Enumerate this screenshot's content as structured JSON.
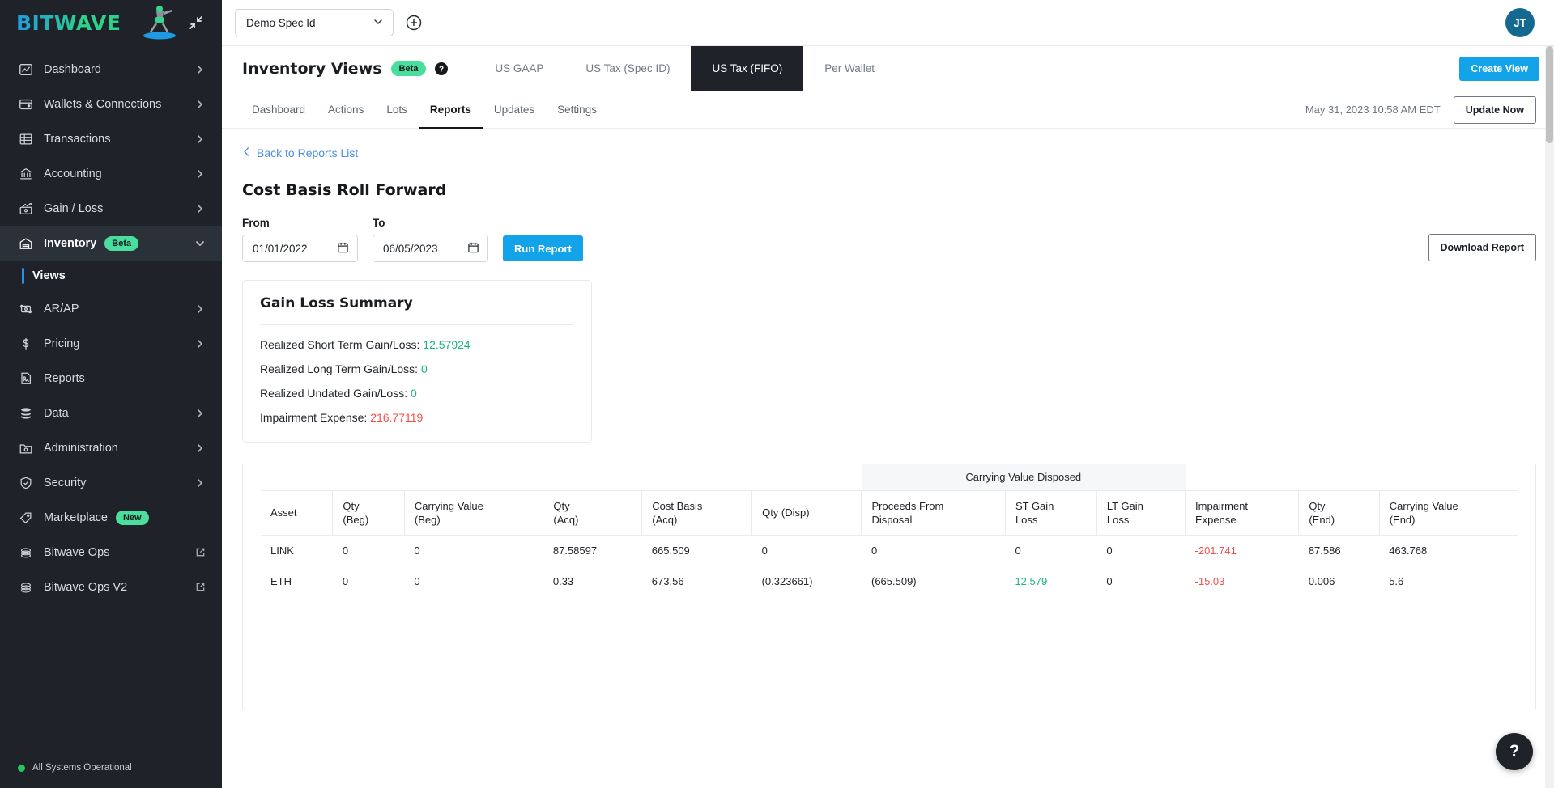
{
  "brand": {
    "name": "BITWAVE",
    "logo_icon": "surfer-logo",
    "collapse_icon": "collapse-icon"
  },
  "sidebar": {
    "items": [
      {
        "label": "Dashboard",
        "icon": "chart-line-icon",
        "chevron": true
      },
      {
        "label": "Wallets & Connections",
        "icon": "wallet-icon",
        "chevron": true
      },
      {
        "label": "Transactions",
        "icon": "table-icon",
        "chevron": true
      },
      {
        "label": "Accounting",
        "icon": "bank-icon",
        "chevron": true
      },
      {
        "label": "Gain / Loss",
        "icon": "gain-loss-icon",
        "chevron": true
      },
      {
        "label": "Inventory",
        "icon": "warehouse-icon",
        "badge": "Beta",
        "chevron": true,
        "active": true
      },
      {
        "label": "AR/AP",
        "icon": "money-transfer-icon",
        "chevron": true
      },
      {
        "label": "Pricing",
        "icon": "dollar-icon",
        "chevron": true
      },
      {
        "label": "Reports",
        "icon": "document-icon",
        "chevron": false
      },
      {
        "label": "Data",
        "icon": "database-icon",
        "chevron": true
      },
      {
        "label": "Administration",
        "icon": "admin-folder-icon",
        "chevron": true
      },
      {
        "label": "Security",
        "icon": "shield-check-icon",
        "chevron": true
      },
      {
        "label": "Marketplace",
        "icon": "tag-icon",
        "badge": "New",
        "chevron": false
      },
      {
        "label": "Bitwave Ops",
        "icon": "stack-icon",
        "external": true
      },
      {
        "label": "Bitwave Ops V2",
        "icon": "stack-icon",
        "external": true
      }
    ],
    "sub_item": {
      "label": "Views"
    },
    "status": {
      "text": "All Systems Operational",
      "color": "#22c55e"
    }
  },
  "topbar": {
    "spec_select": {
      "value": "Demo Spec Id",
      "chevron_icon": "chevron-down-icon"
    },
    "add_icon": "plus-circle-icon",
    "avatar": {
      "initials": "JT"
    }
  },
  "view_header": {
    "title": "Inventory Views",
    "badge": "Beta",
    "help_icon": "help-circle-icon",
    "tabs": [
      {
        "label": "US GAAP",
        "active": false
      },
      {
        "label": "US Tax (Spec ID)",
        "active": false
      },
      {
        "label": "US Tax (FIFO)",
        "active": true
      },
      {
        "label": "Per Wallet",
        "active": false
      }
    ],
    "create_view_label": "Create View"
  },
  "subnav": {
    "tabs": [
      {
        "label": "Dashboard",
        "active": false
      },
      {
        "label": "Actions",
        "active": false
      },
      {
        "label": "Lots",
        "active": false
      },
      {
        "label": "Reports",
        "active": true
      },
      {
        "label": "Updates",
        "active": false
      },
      {
        "label": "Settings",
        "active": false
      }
    ],
    "timestamp": "May 31, 2023 10:58 AM EDT",
    "update_now_label": "Update Now"
  },
  "report": {
    "back_link": "Back to Reports List",
    "back_icon": "chevron-left-icon",
    "title": "Cost Basis Roll Forward",
    "from_label": "From",
    "to_label": "To",
    "from_value": "01/01/2022",
    "to_value": "06/05/2023",
    "calendar_icon": "calendar-icon",
    "run_report_label": "Run Report",
    "download_report_label": "Download Report"
  },
  "summary": {
    "title": "Gain Loss Summary",
    "rows": [
      {
        "label": "Realized Short Term Gain/Loss:",
        "value": "12.57924",
        "tone": "green"
      },
      {
        "label": "Realized Long Term Gain/Loss:",
        "value": "0",
        "tone": "green"
      },
      {
        "label": "Realized Undated Gain/Loss:",
        "value": "0",
        "tone": "green"
      },
      {
        "label": "Impairment Expense:",
        "value": "216.77119",
        "tone": "red"
      }
    ]
  },
  "table": {
    "group_header": "Carrying Value Disposed",
    "columns": [
      "Asset",
      "Qty\n(Beg)",
      "Carrying Value\n(Beg)",
      "Qty\n(Acq)",
      "Cost Basis\n(Acq)",
      "Qty (Disp)",
      "Proceeds From\nDisposal",
      "ST Gain\nLoss",
      "LT Gain\nLoss",
      "Impairment\nExpense",
      "Qty\n(End)",
      "Carrying Value\n(End)"
    ],
    "columns_line1": [
      "Asset",
      "Qty",
      "Carrying Value",
      "Qty",
      "Cost Basis",
      "Qty (Disp)",
      "Proceeds From",
      "ST Gain",
      "LT Gain",
      "Impairment",
      "Qty",
      "Carrying Value"
    ],
    "columns_line2": [
      "",
      "(Beg)",
      "(Beg)",
      "(Acq)",
      "(Acq)",
      "",
      "Disposal",
      "Loss",
      "Loss",
      "Expense",
      "(End)",
      "(End)"
    ],
    "rows": [
      {
        "asset": "LINK",
        "qty_beg": "0",
        "carrying_value_beg": "0",
        "qty_acq": "87.58597",
        "cost_basis_acq": "665.509",
        "qty_disp": "0",
        "proceeds_from_disposal": "0",
        "st_gain_loss": "0",
        "st_tone": "neutral",
        "lt_gain_loss": "0",
        "impairment_expense": "-201.741",
        "impairment_tone": "red",
        "qty_end": "87.586",
        "carrying_value_end": "463.768"
      },
      {
        "asset": "ETH",
        "qty_beg": "0",
        "carrying_value_beg": "0",
        "qty_acq": "0.33",
        "cost_basis_acq": "673.56",
        "qty_disp": "(0.323661)",
        "proceeds_from_disposal": "(665.509)",
        "st_gain_loss": "12.579",
        "st_tone": "green",
        "lt_gain_loss": "0",
        "impairment_expense": "-15.03",
        "impairment_tone": "red",
        "qty_end": "0.006",
        "carrying_value_end": "5.6"
      }
    ]
  },
  "fab": {
    "label": "?",
    "icon": "help-icon"
  },
  "colors": {
    "accent_blue": "#13a3e8",
    "green": "#19b77f",
    "red": "#f0504c",
    "sidebar_bg": "#1f2329",
    "badge_green": "#4ade9e",
    "link_blue": "#4a8fe0"
  }
}
